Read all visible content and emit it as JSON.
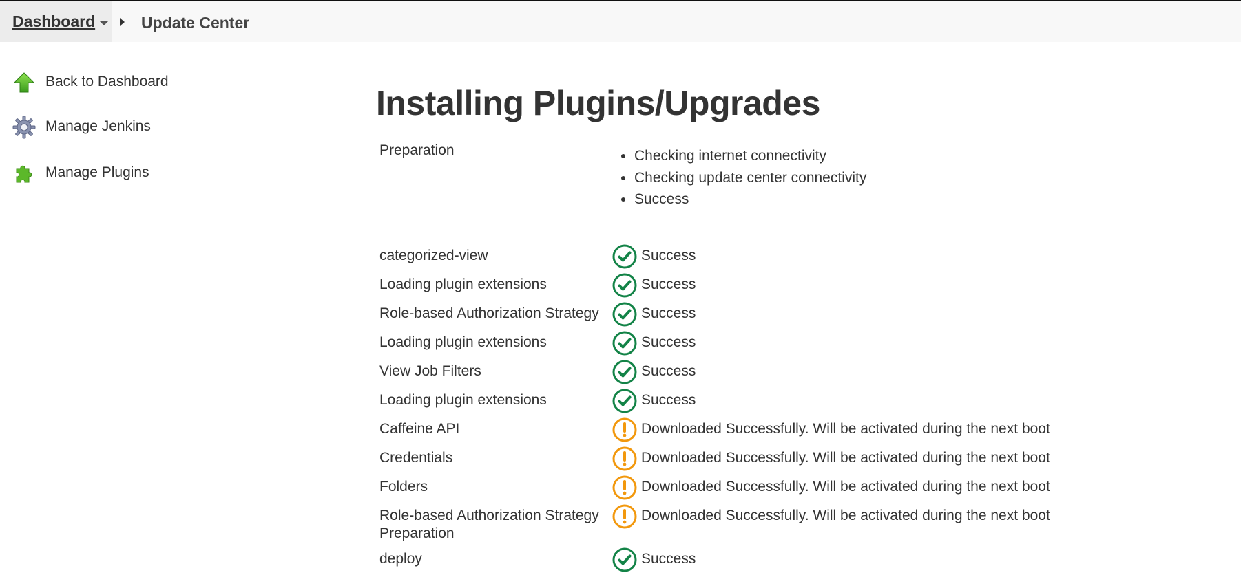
{
  "breadcrumb": {
    "home": "Dashboard",
    "current": "Update Center"
  },
  "sidebar": {
    "items": [
      {
        "label": "Back to Dashboard",
        "icon": "up-arrow-icon"
      },
      {
        "label": "Manage Jenkins",
        "icon": "gear-icon"
      },
      {
        "label": "Manage Plugins",
        "icon": "puzzle-icon"
      }
    ]
  },
  "main": {
    "title": "Installing Plugins/Upgrades",
    "preparation": {
      "label": "Preparation",
      "steps": [
        "Checking internet connectivity",
        "Checking update center connectivity",
        "Success"
      ]
    },
    "jobs": [
      {
        "name": "categorized-view",
        "status": "Success",
        "state": "success"
      },
      {
        "name": "Loading plugin extensions",
        "status": "Success",
        "state": "success"
      },
      {
        "name": "Role-based Authorization Strategy",
        "status": "Success",
        "state": "success"
      },
      {
        "name": "Loading plugin extensions",
        "status": "Success",
        "state": "success"
      },
      {
        "name": "View Job Filters",
        "status": "Success",
        "state": "success"
      },
      {
        "name": "Loading plugin extensions",
        "status": "Success",
        "state": "success"
      },
      {
        "name": "Caffeine API",
        "status": "Downloaded Successfully. Will be activated during the next boot",
        "state": "warning"
      },
      {
        "name": "Credentials",
        "status": "Downloaded Successfully. Will be activated during the next boot",
        "state": "warning"
      },
      {
        "name": "Folders",
        "status": "Downloaded Successfully. Will be activated during the next boot",
        "state": "warning"
      },
      {
        "name": "Role-based Authorization Strategy",
        "status": "Downloaded Successfully. Will be activated during the next boot",
        "state": "warning"
      }
    ],
    "preparation2": {
      "label": "Preparation"
    },
    "deploy": {
      "name": "deploy",
      "status": "Success",
      "state": "success"
    }
  },
  "colors": {
    "success": "#138347",
    "warning": "#f2980d",
    "icon_green": "#5cb82a"
  }
}
